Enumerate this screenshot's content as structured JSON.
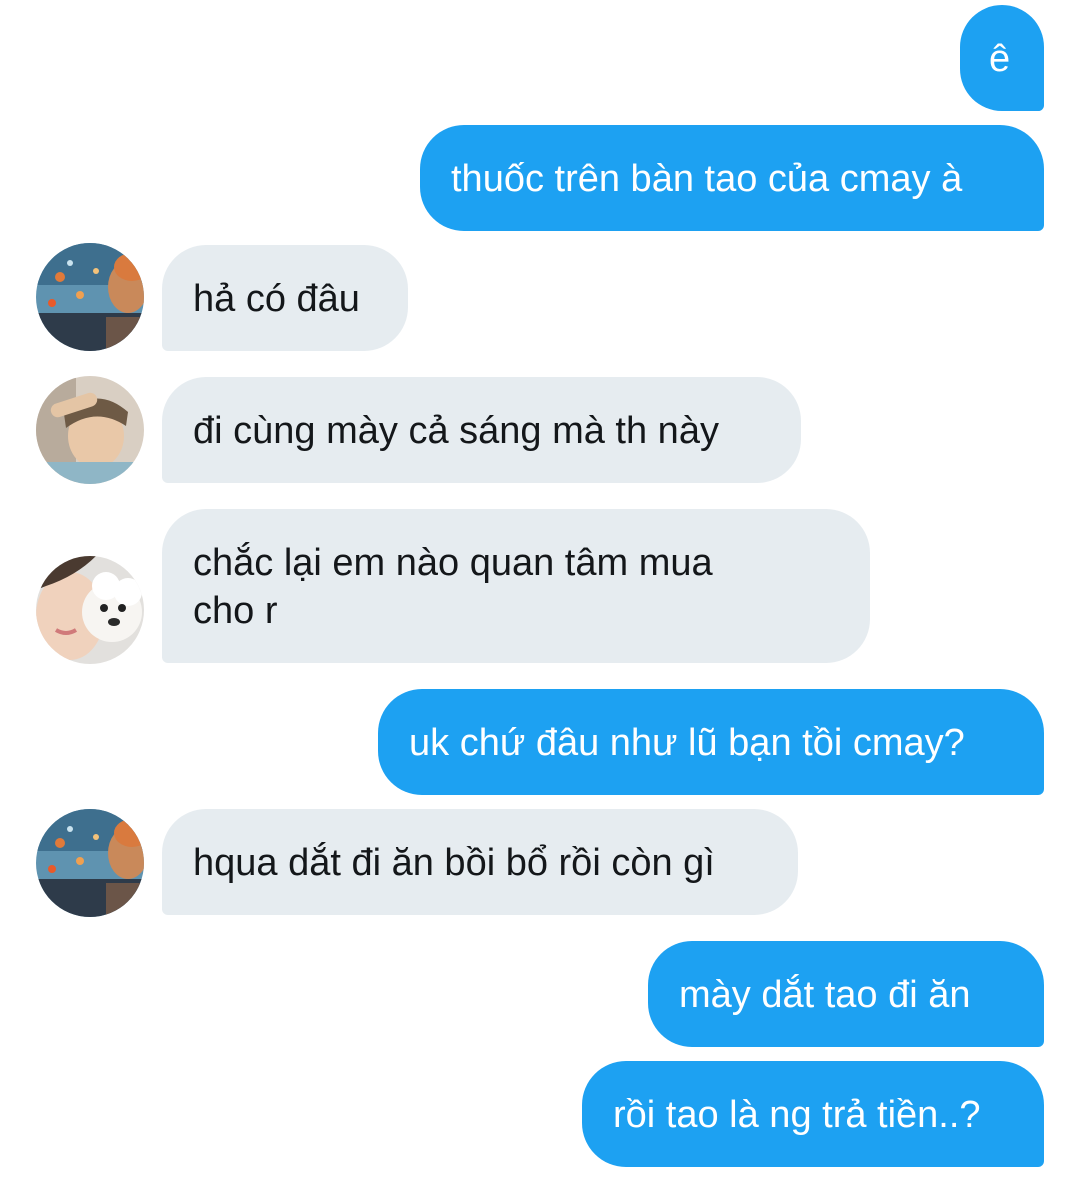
{
  "conversation": {
    "messages": [
      {
        "direction": "outgoing",
        "text": "ê"
      },
      {
        "direction": "outgoing",
        "text": "thuốc trên bàn tao của cmay à"
      },
      {
        "direction": "incoming",
        "avatar": "aquarium-photo-avatar",
        "text": "hả có đâu"
      },
      {
        "direction": "incoming",
        "avatar": "person-portrait-avatar",
        "text": "đi cùng mày cả sáng mà th này"
      },
      {
        "direction": "incoming",
        "avatar": "person-with-dog-avatar",
        "text": "chắc lại em nào quan tâm mua",
        "text_line2": "cho r"
      },
      {
        "direction": "outgoing",
        "text": "uk chứ đâu như lũ bạn tồi cmay?"
      },
      {
        "direction": "incoming",
        "avatar": "aquarium-photo-avatar",
        "text": "hqua dắt đi ăn bồi bổ rồi còn gì"
      },
      {
        "direction": "outgoing",
        "text": "mày dắt tao đi ăn"
      },
      {
        "direction": "outgoing",
        "text": "rồi tao là ng trả tiền..?"
      }
    ]
  },
  "colors": {
    "outgoing_bubble": "#1da1f2",
    "incoming_bubble": "#e6ecf0",
    "incoming_text": "#14171a",
    "background": "#ffffff"
  }
}
